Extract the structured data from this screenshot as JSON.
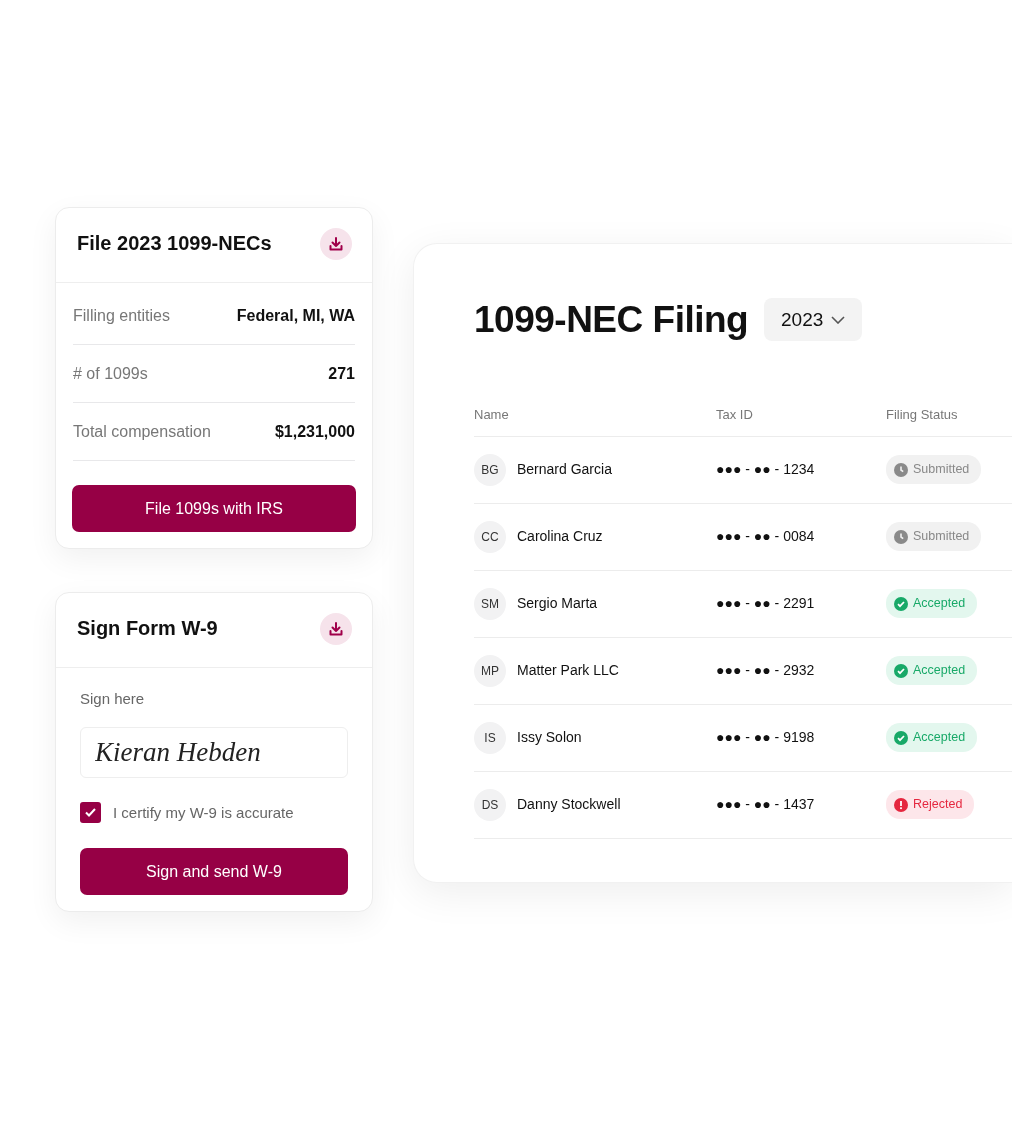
{
  "file_card": {
    "title": "File 2023 1099-NECs",
    "rows": [
      {
        "label": "Filling entities",
        "value": "Federal, MI, WA"
      },
      {
        "label": "# of 1099s",
        "value": "271"
      },
      {
        "label": "Total compensation",
        "value": "$1,231,000"
      }
    ],
    "button": "File 1099s with IRS"
  },
  "sign_card": {
    "title": "Sign Form W-9",
    "label": "Sign here",
    "signature": "Kieran Hebden",
    "certify": {
      "label": "I certify my W-9 is accurate",
      "checked": true
    },
    "button": "Sign and send W-9"
  },
  "filing": {
    "title": "1099-NEC Filing",
    "year": "2023",
    "columns": [
      "Name",
      "Tax ID",
      "Filing Status"
    ],
    "rows": [
      {
        "initials": "BG",
        "name": "Bernard Garcia",
        "tax_id": "●●● - ●● - 1234",
        "status": {
          "kind": "submitted",
          "label": "Submitted"
        }
      },
      {
        "initials": "CC",
        "name": "Carolina Cruz",
        "tax_id": "●●● - ●● - 0084",
        "status": {
          "kind": "submitted",
          "label": "Submitted"
        }
      },
      {
        "initials": "SM",
        "name": "Sergio Marta",
        "tax_id": "●●● - ●● - 2291",
        "status": {
          "kind": "accepted",
          "label": "Accepted"
        }
      },
      {
        "initials": "MP",
        "name": "Matter Park LLC",
        "tax_id": "●●● - ●● - 2932",
        "status": {
          "kind": "accepted",
          "label": "Accepted"
        }
      },
      {
        "initials": "IS",
        "name": "Issy Solon",
        "tax_id": "●●● - ●● - 9198",
        "status": {
          "kind": "accepted",
          "label": "Accepted"
        }
      },
      {
        "initials": "DS",
        "name": "Danny Stockwell",
        "tax_id": "●●● - ●● - 1437",
        "status": {
          "kind": "rejected",
          "label": "Rejected"
        }
      }
    ]
  }
}
